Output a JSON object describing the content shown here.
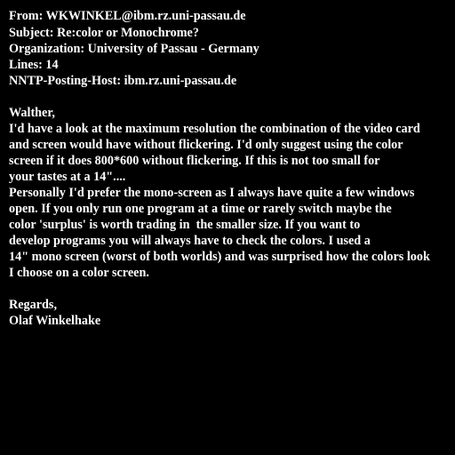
{
  "headers": {
    "from": "From: WKWINKEL@ibm.rz.uni-passau.de",
    "subject": "Subject: Re:color or Monochrome?",
    "organization": "Organization: University of Passau - Germany",
    "lines": "Lines: 14",
    "nntp_host": "NNTP-Posting-Host: ibm.rz.uni-passau.de"
  },
  "body": {
    "greeting": "Walther,",
    "paragraph1": [
      "I'd have a look at the maximum resolution the combination of the video card",
      "and screen would have without flickering. I'd only suggest using the color",
      "screen if it does 800*600 without flickering. If this is not too small for",
      "your tastes at a 14\"...."
    ],
    "paragraph2": [
      "Personally I'd prefer the mono-screen as I always have quite a few windows",
      "open. If you only run one program at a time or rarely switch maybe the",
      "color 'surplus' is worth trading in  the smaller size. If you want to",
      "develop programs you will always have to check the colors. I used a",
      "14\" mono screen (worst of both worlds) and was surprised how the colors look",
      "I choose on a color screen."
    ],
    "closing": "Regards,",
    "signature": "Olaf Winkelhake"
  }
}
